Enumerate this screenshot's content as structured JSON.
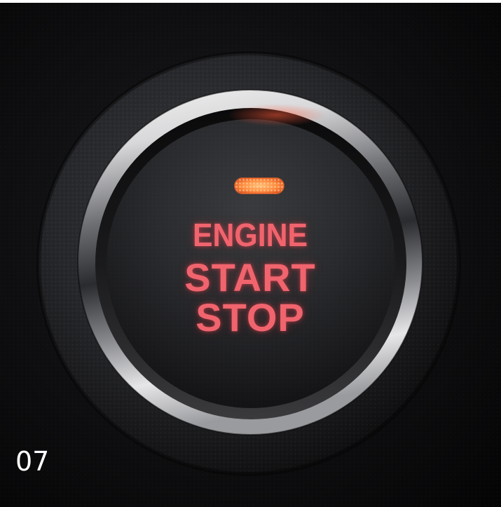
{
  "button": {
    "line1": "ENGINE",
    "line2": "START",
    "line3": "STOP",
    "label_color": "#f0646e",
    "indicator_color": "#ff8a3d"
  },
  "index_label": "07"
}
